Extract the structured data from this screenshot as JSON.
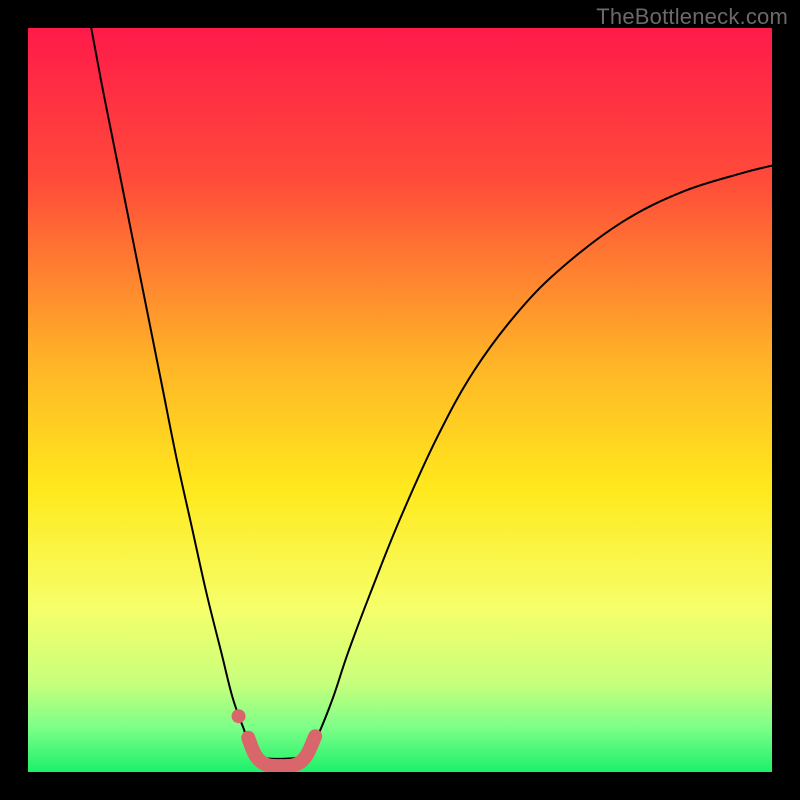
{
  "watermark": "TheBottleneck.com",
  "chart_data": {
    "type": "line",
    "title": "",
    "xlabel": "",
    "ylabel": "",
    "xlim": [
      0,
      1
    ],
    "ylim": [
      0,
      1
    ],
    "grid": false,
    "legend": false,
    "gradient_stops": [
      {
        "offset": 0.0,
        "color": "#ff1a4a"
      },
      {
        "offset": 0.2,
        "color": "#ff4a3a"
      },
      {
        "offset": 0.45,
        "color": "#ffb427"
      },
      {
        "offset": 0.62,
        "color": "#ffe91d"
      },
      {
        "offset": 0.78,
        "color": "#f6ff6a"
      },
      {
        "offset": 0.88,
        "color": "#c8ff7c"
      },
      {
        "offset": 0.94,
        "color": "#7dff88"
      },
      {
        "offset": 1.0,
        "color": "#1cf06a"
      }
    ],
    "series": [
      {
        "name": "bottleneck-curve",
        "color": "#000000",
        "stroke_width": 2,
        "x": [
          0.085,
          0.1,
          0.12,
          0.14,
          0.16,
          0.18,
          0.2,
          0.22,
          0.24,
          0.26,
          0.275,
          0.29,
          0.305,
          0.375,
          0.39,
          0.41,
          0.43,
          0.46,
          0.5,
          0.55,
          0.6,
          0.66,
          0.72,
          0.8,
          0.88,
          0.96,
          1.0
        ],
        "y": [
          1.0,
          0.92,
          0.82,
          0.72,
          0.62,
          0.52,
          0.42,
          0.33,
          0.24,
          0.16,
          0.1,
          0.058,
          0.022,
          0.022,
          0.05,
          0.1,
          0.16,
          0.24,
          0.34,
          0.45,
          0.54,
          0.62,
          0.68,
          0.74,
          0.78,
          0.805,
          0.815
        ]
      },
      {
        "name": "marker-segment",
        "color": "#d9666b",
        "stroke_width": 14,
        "linecap": "round",
        "x": [
          0.296,
          0.306,
          0.32,
          0.34,
          0.36,
          0.374,
          0.386
        ],
        "y": [
          0.046,
          0.022,
          0.01,
          0.008,
          0.01,
          0.022,
          0.048
        ]
      }
    ],
    "markers": [
      {
        "name": "left-dot",
        "x": 0.283,
        "y": 0.075,
        "r": 7,
        "color": "#d9666b"
      }
    ]
  }
}
